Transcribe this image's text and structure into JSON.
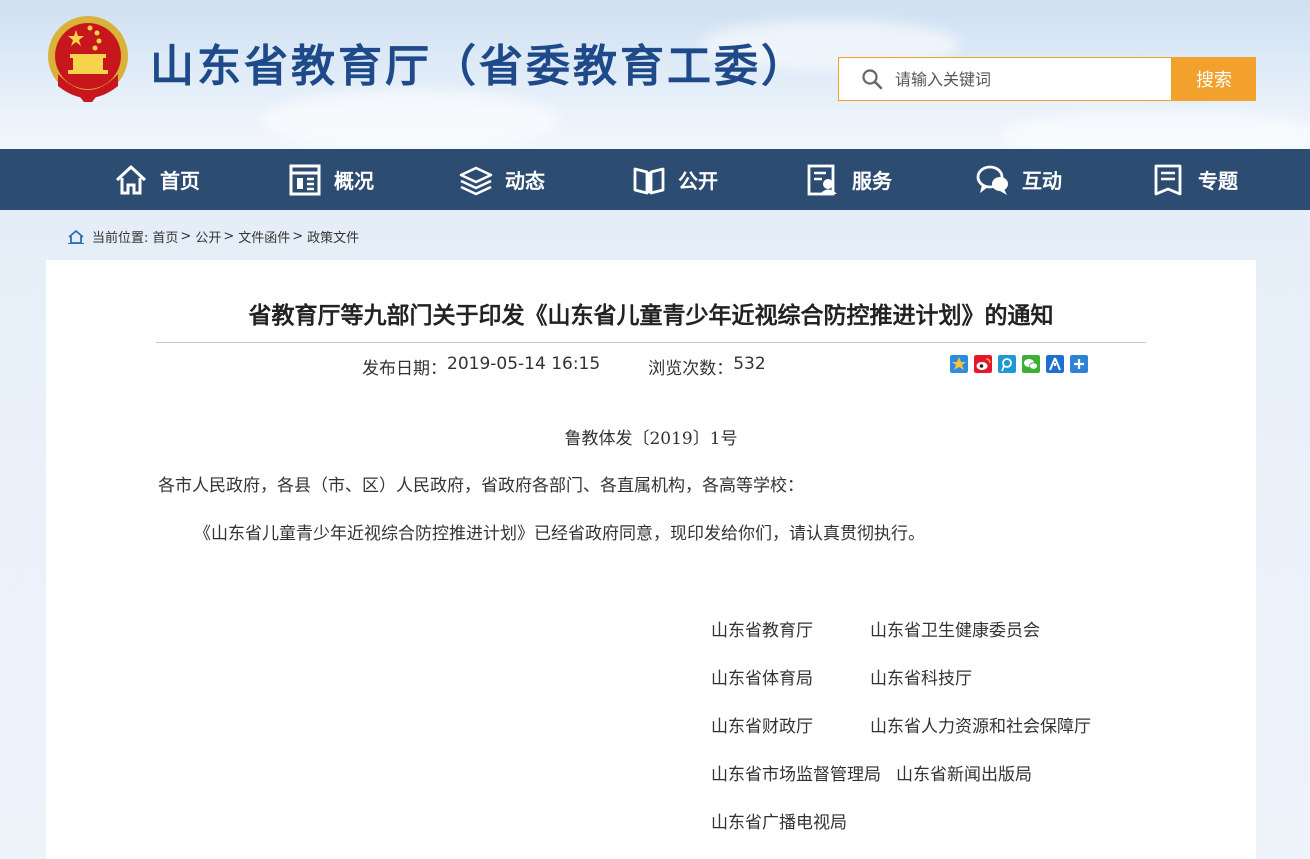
{
  "header": {
    "site_title": "山东省教育厅（省委教育工委）",
    "search_placeholder": "请输入关键词",
    "search_button": "搜索"
  },
  "nav": {
    "items": [
      {
        "label": "首页",
        "icon": "home-icon"
      },
      {
        "label": "概况",
        "icon": "overview-icon"
      },
      {
        "label": "动态",
        "icon": "news-stack-icon"
      },
      {
        "label": "公开",
        "icon": "open-book-icon"
      },
      {
        "label": "服务",
        "icon": "service-icon"
      },
      {
        "label": "互动",
        "icon": "chat-bubble-icon"
      },
      {
        "label": "专题",
        "icon": "topic-doc-icon"
      }
    ]
  },
  "breadcrumb": {
    "prefix": "当前位置:",
    "items": [
      "首页",
      "公开",
      "文件函件",
      "政策文件"
    ],
    "separator": ">"
  },
  "article": {
    "title": "省教育厅等九部门关于印发《山东省儿童青少年近视综合防控推进计划》的通知",
    "publish_label": "发布日期：",
    "publish_date": "2019-05-14 16:15",
    "views_label": "浏览次数：",
    "views": "532",
    "doc_number": "鲁教体发〔2019〕1号",
    "recipients": "各市人民政府，各县（市、区）人民政府，省政府各部门、各直属机构，各高等学校：",
    "body": "《山东省儿童青少年近视综合防控推进计划》已经省政府同意，现印发给你们，请认真贯彻执行。",
    "signers": [
      [
        "山东省教育厅",
        "山东省卫生健康委员会"
      ],
      [
        "山东省体育局",
        "山东省科技厅"
      ],
      [
        "山东省财政厅",
        "山东省人力资源和社会保障厅"
      ],
      [
        "山东省市场监督管理局",
        "山东省新闻出版局"
      ],
      [
        "山东省广播电视局",
        ""
      ]
    ]
  },
  "share_icons": [
    "qzone-icon",
    "weibo-icon",
    "tencent-weibo-icon",
    "wechat-icon",
    "renren-icon",
    "more-share-icon"
  ],
  "colors": {
    "nav_bg": "#2d4c72",
    "title_blue": "#1f4a8a",
    "accent_orange": "#f2a12d"
  }
}
